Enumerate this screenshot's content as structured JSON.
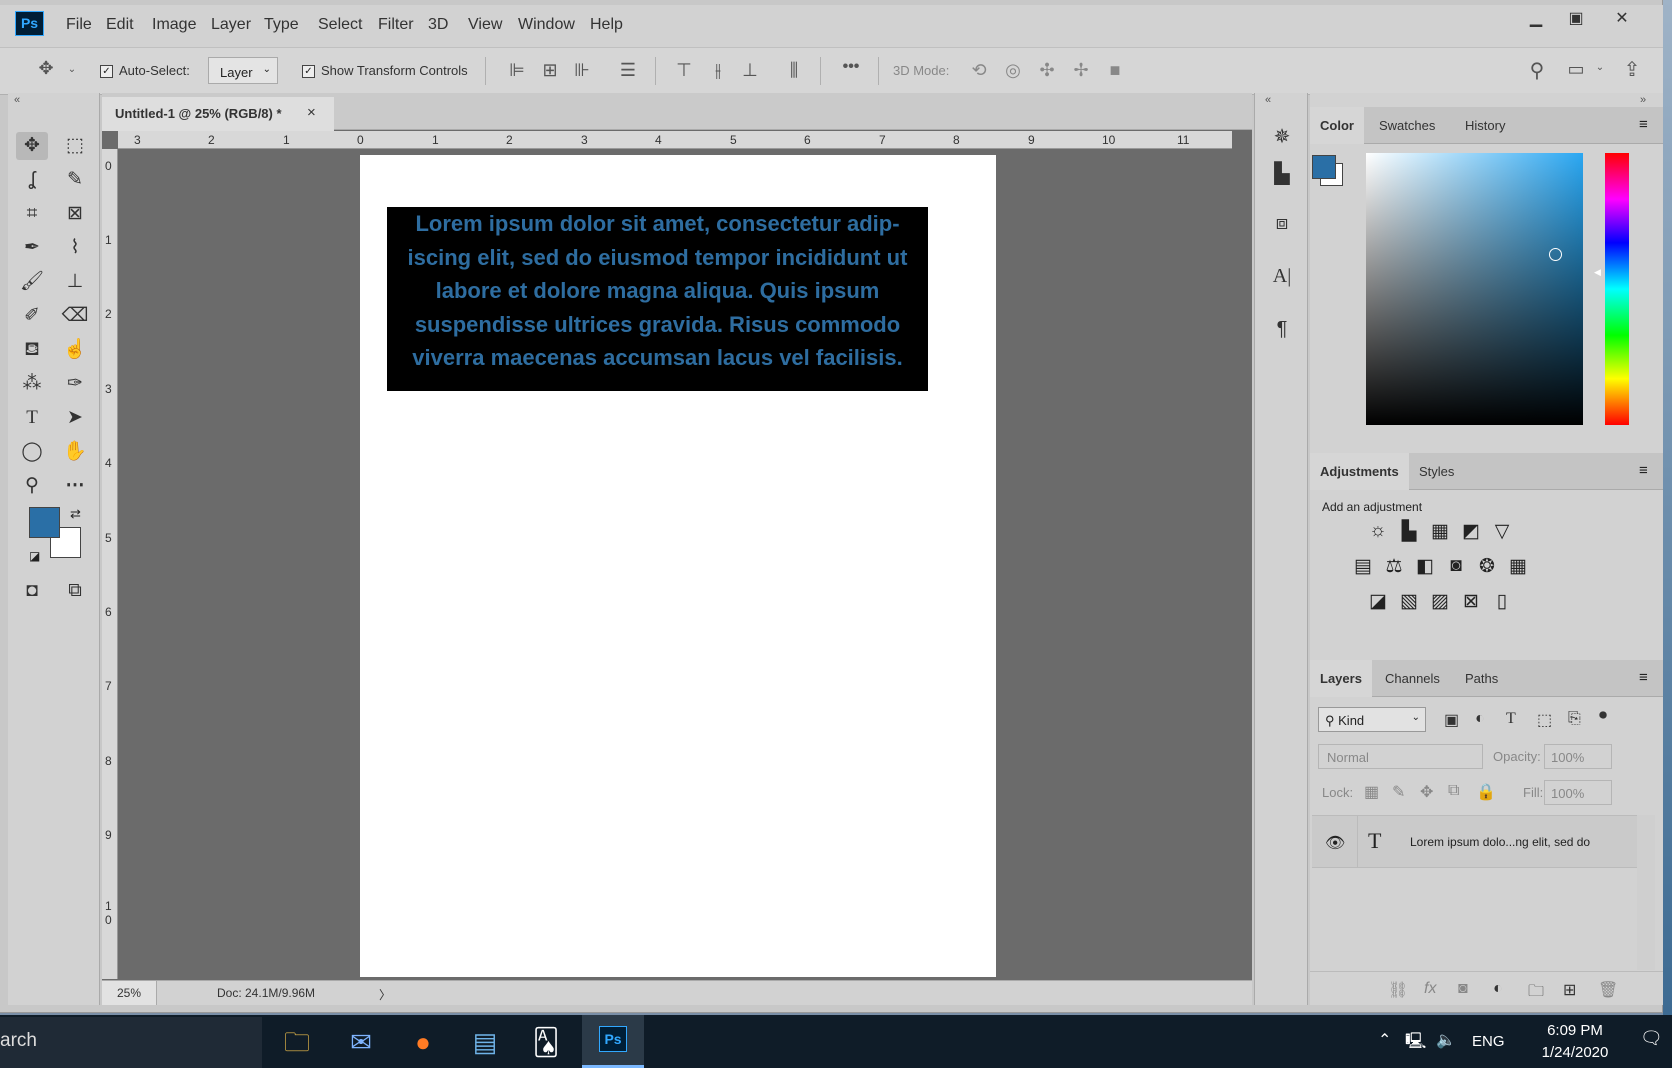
{
  "app": {
    "logo": "Ps",
    "menus": [
      "File",
      "Edit",
      "Image",
      "Layer",
      "Type",
      "Select",
      "Filter",
      "3D",
      "View",
      "Window",
      "Help"
    ],
    "window_buttons": [
      "minimize-icon",
      "restore-icon",
      "close-icon"
    ]
  },
  "options": {
    "auto_select_label": "Auto-Select:",
    "auto_select_checked": true,
    "auto_select_value": "Layer",
    "show_transform_label": "Show Transform Controls",
    "more": "•••",
    "mode_3d_label": "3D Mode:"
  },
  "document": {
    "tab_title": "Untitled-1 @ 25% (RGB/8) *",
    "close": "×",
    "text_content": "Lorem ipsum dolor sit amet, consectetur adip- iscing elit, sed do eiusmod tempor incididunt ut labore et dolore magna aliqua. Quis ipsum suspendisse ultrices gravida. Risus commodo viverra maecenas accumsan lacus vel facilisis.",
    "text_color": "#2e6da0",
    "ruler_top": [
      "3",
      "2",
      "1",
      "0",
      "1",
      "2",
      "3",
      "4",
      "5",
      "6",
      "7",
      "8",
      "9",
      "10",
      "11"
    ],
    "ruler_left": [
      "0",
      "1",
      "2",
      "3",
      "4",
      "5",
      "6",
      "7",
      "8",
      "9",
      "1",
      "0"
    ]
  },
  "status": {
    "zoom": "25%",
    "doc_info": "Doc: 24.1M/9.96M",
    "arrow": "〉"
  },
  "colors": {
    "foreground": "#2a6fa6",
    "background": "#ffffff"
  },
  "color_panel": {
    "tabs": [
      "Color",
      "Swatches",
      "History"
    ],
    "active": "Color"
  },
  "adjustments_panel": {
    "tabs": [
      "Adjustments",
      "Styles"
    ],
    "active": "Adjustments",
    "hint": "Add an adjustment"
  },
  "layers_panel": {
    "tabs": [
      "Layers",
      "Channels",
      "Paths"
    ],
    "active": "Layers",
    "filter_kind": "Kind",
    "blend_mode": "Normal",
    "opacity_label": "Opacity:",
    "opacity_value": "100%",
    "lock_label": "Lock:",
    "fill_label": "Fill:",
    "fill_value": "100%",
    "layers": [
      {
        "name": "Lorem ipsum dolo...ng elit, sed do",
        "type_glyph": "T",
        "visible": true
      }
    ]
  },
  "taskbar": {
    "search_text": "arch",
    "language": "ENG",
    "time": "6:09 PM",
    "date": "1/24/2020"
  }
}
